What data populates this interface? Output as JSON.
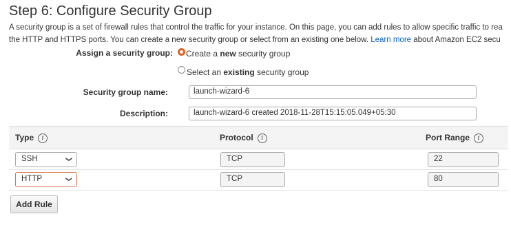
{
  "title": "Step 6: Configure Security Group",
  "description": {
    "line1": "A security group is a set of firewall rules that control the traffic for your instance. On this page, you can add rules to allow specific traffic to rea",
    "line2_pre": "the HTTP and HTTPS ports. You can create a new security group or select from an existing one below. ",
    "learn_more": "Learn more",
    "line2_post": " about Amazon EC2 secu"
  },
  "assign": {
    "label": "Assign a security group:",
    "option_new": {
      "pre": "Create a ",
      "bold": "new",
      "post": " security group",
      "selected": true
    },
    "option_existing": {
      "pre": "Select an ",
      "bold": "existing",
      "post": " security group",
      "selected": false
    }
  },
  "form": {
    "name_label": "Security group name:",
    "name_value": "launch-wizard-6",
    "desc_label": "Description:",
    "desc_value": "launch-wizard-6 created 2018-11-28T15:15:05.049+05:30"
  },
  "table": {
    "headers": {
      "type": "Type",
      "protocol": "Protocol",
      "port": "Port Range"
    },
    "info_icon": "i",
    "rows": [
      {
        "type": "SSH",
        "protocol": "TCP",
        "port": "22"
      },
      {
        "type": "HTTP",
        "protocol": "TCP",
        "port": "80"
      }
    ]
  },
  "add_rule_label": "Add Rule",
  "colors": {
    "accent": "#e2621b",
    "link": "#1166bb",
    "error_border": "#d9744f"
  }
}
